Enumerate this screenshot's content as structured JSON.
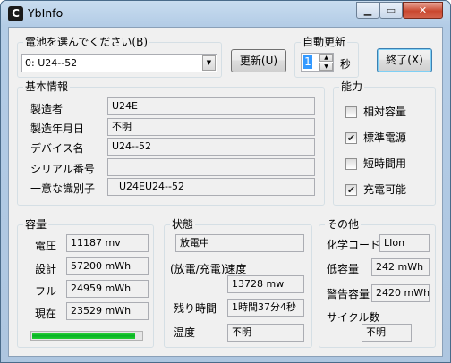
{
  "window": {
    "title": "YbInfo",
    "icon": "yb-app-icon",
    "buttons": {
      "minimize": "minimize-icon",
      "maximize": "maximize-icon",
      "close": "close-icon"
    }
  },
  "battery_select": {
    "label": "電池を選んでください(B)",
    "value": "0: U24--52"
  },
  "refresh_button": "更新(U)",
  "auto_update": {
    "label": "自動更新",
    "value": "1",
    "unit": "秒"
  },
  "exit_button": "終了(X)",
  "basic_info": {
    "title": "基本情報",
    "rows": [
      {
        "label": "製造者",
        "value": "U24E"
      },
      {
        "label": "製造年月日",
        "value": "不明"
      },
      {
        "label": "デバイス名",
        "value": "U24--52"
      },
      {
        "label": "シリアル番号",
        "value": ""
      },
      {
        "label": "一意な識別子",
        "value": "U24EU24--52"
      }
    ]
  },
  "capability": {
    "title": "能力",
    "items": [
      {
        "label": "相対容量",
        "checked": false
      },
      {
        "label": "標準電源",
        "checked": true
      },
      {
        "label": "短時間用",
        "checked": false
      },
      {
        "label": "充電可能",
        "checked": true
      }
    ]
  },
  "capacity": {
    "title": "容量",
    "rows": [
      {
        "label": "電圧",
        "value": "11187 mv"
      },
      {
        "label": "設計",
        "value": "57200 mWh"
      },
      {
        "label": "フル",
        "value": "24959 mWh"
      },
      {
        "label": "現在",
        "value": "23529 mWh"
      }
    ],
    "charge_fraction": 0.94,
    "bar_color": "#06b025"
  },
  "status": {
    "title": "状態",
    "state": "放電中",
    "rate_label": "(放電/充電)速度",
    "rate_value": "13728 mw",
    "remaining_label": "残り時間",
    "remaining_value": "1時間37分4秒",
    "temp_label": "温度",
    "temp_value": "不明"
  },
  "other": {
    "title": "その他",
    "chemistry_label": "化学コード",
    "chemistry_value": "LIon",
    "low_label": "低容量",
    "low_value": "242 mWh",
    "warn_label": "警告容量",
    "warn_value": "2420 mWh",
    "cycle_label": "サイクル数",
    "cycle_value": "不明"
  }
}
